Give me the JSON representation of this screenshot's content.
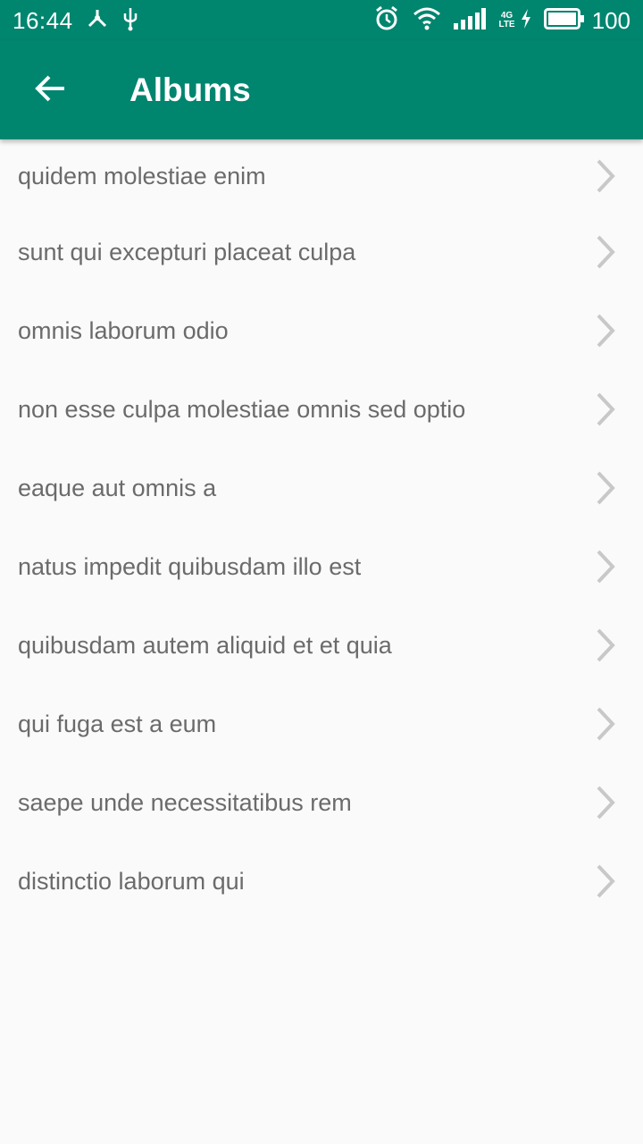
{
  "status_bar": {
    "time": "16:44",
    "net_top": "4G",
    "net_bottom": "LTE",
    "battery": "100",
    "icons": [
      "share-icon",
      "usb-icon",
      "alarm-icon",
      "wifi-icon",
      "signal-icon",
      "charging-icon",
      "battery-icon"
    ]
  },
  "app_bar": {
    "title": "Albums",
    "back_icon": "arrow-back-icon",
    "color": "#00856f"
  },
  "albums": [
    {
      "title": "quidem molestiae enim"
    },
    {
      "title": "sunt qui excepturi placeat culpa"
    },
    {
      "title": "omnis laborum odio"
    },
    {
      "title": "non esse culpa molestiae omnis sed optio"
    },
    {
      "title": "eaque aut omnis a"
    },
    {
      "title": "natus impedit quibusdam illo est"
    },
    {
      "title": "quibusdam autem aliquid et et quia"
    },
    {
      "title": "qui fuga est a eum"
    },
    {
      "title": "saepe unde necessitatibus rem"
    },
    {
      "title": "distinctio laborum qui"
    }
  ],
  "item_icon": "chevron-right-icon"
}
